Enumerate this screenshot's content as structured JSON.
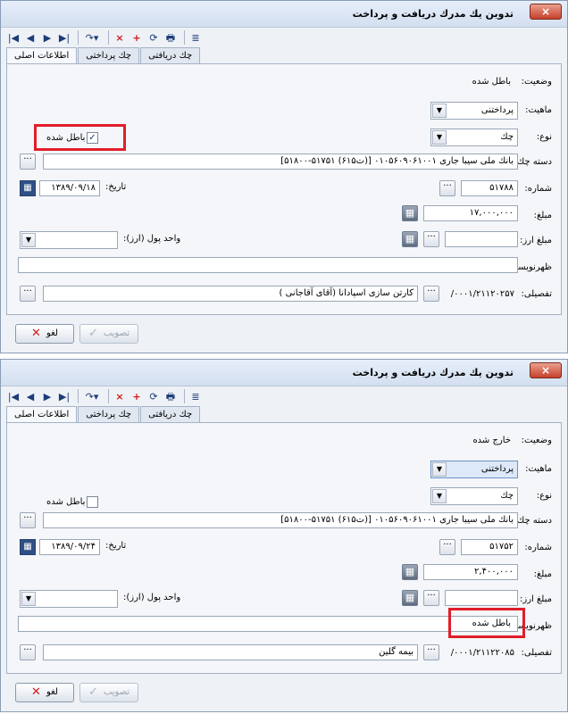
{
  "windows": [
    {
      "title": "تدوین یك مدرك دریافت و پرداخت",
      "close": "×",
      "toolbar": [
        "|◀",
        "◀",
        "▶",
        "▶|",
        "↷▾",
        "×",
        "+",
        "⟳",
        "🖶",
        "≣"
      ],
      "tabs": [
        "اطلاعات اصلی",
        "چك پرداختی",
        "چك دریافتی"
      ],
      "status_label": "وضعیت:",
      "status_value": "باطل شده",
      "nature_label": "ماهیت:",
      "nature_value": "پرداختنی",
      "type_label": "نوع:",
      "type_value": "چك",
      "void_label": "باطل شده",
      "void_checked": "✓",
      "checkbook_label": "دسته چك:",
      "checkbook_value": "بانك ملی سیبا جاری ۰۱۰۵۶۰۹۰۶۱۰۰۱ [(ت۶۱۵) ۵۱۷۵۱-۵۱۸۰۰]",
      "date_label": "تاریخ:",
      "date_value": "۱۳۸۹/۰۹/۱۸",
      "number_label": "شماره:",
      "number_value": "۵۱۷۸۸",
      "amount_label": "مبلغ:",
      "amount_value": "۱۷,۰۰۰,۰۰۰",
      "currency_amount_label": "مبلغ ارز:",
      "currency_amount_value": "",
      "currency_unit_label": "واحد پول (ارز):",
      "currency_unit_value": "",
      "endorsement_label": "ظهرنویسی:",
      "endorsement_value": "",
      "detail_label": "تفصیلی:",
      "detail_code": "۰۰۰۱/۲۱۱۲۰۲۵۷/",
      "detail_name": "كارتن سازی اسپادانا (آقای آقاجانی )",
      "cancel_label": "لغو",
      "approve_label": "تصویب"
    },
    {
      "title": "تدوین یك مدرك دریافت و پرداخت",
      "close": "×",
      "toolbar": [
        "|◀",
        "◀",
        "▶",
        "▶|",
        "↷▾",
        "×",
        "+",
        "⟳",
        "🖶",
        "≣"
      ],
      "tabs": [
        "اطلاعات اصلی",
        "چك پرداختی",
        "چك دریافتی"
      ],
      "status_label": "وضعیت:",
      "status_value": "خارج شده",
      "nature_label": "ماهیت:",
      "nature_value": "پرداختنی",
      "type_label": "نوع:",
      "type_value": "چك",
      "void_label": "باطل شده",
      "void_checked": "",
      "checkbook_label": "دسته چك:",
      "checkbook_value": "بانك ملی سیبا جاری ۰۱۰۵۶۰۹۰۶۱۰۰۱ [(ت۶۱۵) ۵۱۷۵۱-۵۱۸۰۰]",
      "date_label": "تاریخ:",
      "date_value": "۱۳۸۹/۰۹/۲۴",
      "number_label": "شماره:",
      "number_value": "۵۱۷۵۲",
      "amount_label": "مبلغ:",
      "amount_value": "۲,۴۰۰,۰۰۰",
      "currency_amount_label": "مبلغ ارز:",
      "currency_amount_value": "",
      "currency_unit_label": "واحد پول (ارز):",
      "currency_unit_value": "",
      "endorsement_label": "ظهرنویسی:",
      "endorsement_value": "باطل شده",
      "detail_label": "تفصیلی:",
      "detail_code": "۰۰۰۱/۲۱۱۲۲۰۸۵/",
      "detail_name": "بیمه گلین",
      "cancel_label": "لغو",
      "approve_label": "تصویب"
    }
  ]
}
